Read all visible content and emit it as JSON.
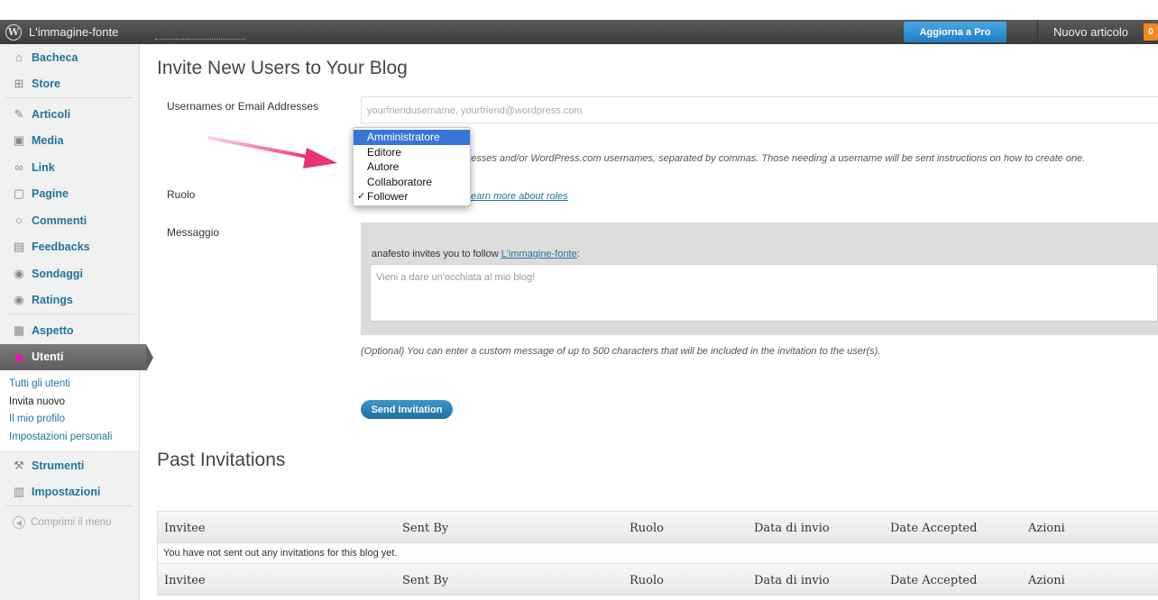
{
  "colors": {
    "adminbar": "#464646",
    "link": "#21759b",
    "upgrade": "#2a8fd3",
    "dropdown_selected": "#3875d7",
    "send_button": "#2b82b5",
    "arrow": "#e8336d"
  },
  "adminbar": {
    "site_name": "L'immagine-fonte",
    "upgrade_label": "Aggiorna a Pro",
    "new_post_label": "Nuovo articolo",
    "notifications_count": "0"
  },
  "sidebar": {
    "items": [
      {
        "label": "Bacheca",
        "icon": "home-icon"
      },
      {
        "label": "Store",
        "icon": "cart-icon"
      },
      {
        "label": "Articoli",
        "icon": "pin-icon"
      },
      {
        "label": "Media",
        "icon": "media-icon"
      },
      {
        "label": "Link",
        "icon": "link-icon"
      },
      {
        "label": "Pagine",
        "icon": "page-icon"
      },
      {
        "label": "Commenti",
        "icon": "comment-icon"
      },
      {
        "label": "Feedbacks",
        "icon": "feedback-icon"
      },
      {
        "label": "Sondaggi",
        "icon": "poll-icon"
      },
      {
        "label": "Ratings",
        "icon": "rating-icon"
      },
      {
        "label": "Aspetto",
        "icon": "appearance-icon"
      },
      {
        "label": "Utenti",
        "icon": "users-icon"
      },
      {
        "label": "Strumenti",
        "icon": "tools-icon"
      },
      {
        "label": "Impostazioni",
        "icon": "settings-icon"
      }
    ],
    "submenu": [
      "Tutti gli utenti",
      "Invita nuovo",
      "Il mio profilo",
      "Impostazioni personali"
    ],
    "collapse_label": "Comprimi il menu"
  },
  "page": {
    "title": "Invite New Users to Your Blog",
    "usernames_label": "Usernames or Email Addresses",
    "usernames_placeholder": "yourfriendusername, yourfriend@wordpress.com",
    "hint": "ldresses and/or WordPress.com usernames, separated by commas. Those needing a username will be sent instructions on how to create one.",
    "role_label": "Ruolo",
    "roles_link": "earn more about roles",
    "message_label": "Messaggio",
    "message_intro": "anafesto invites you to follow ",
    "message_intro_link": "L'immagine-fonte",
    "message_intro_suffix": ":",
    "message_placeholder": "Vieni a dare un'occhiata al mio blog!",
    "optional_note": "(Optional) You can enter a custom message of up to 500 characters that will be included in the invitation to the user(s).",
    "send_label": "Send Invitation",
    "past_title": "Past Invitations"
  },
  "role_dropdown": {
    "options": [
      "Amministratore",
      "Editore",
      "Autore",
      "Collaboratore",
      "Follower"
    ],
    "highlighted": "Amministratore",
    "selected": "Follower"
  },
  "table": {
    "columns": [
      "Invitee",
      "Sent By",
      "Ruolo",
      "Data di invio",
      "Date Accepted",
      "Azioni"
    ],
    "empty_message": "You have not sent out any invitations for this blog yet."
  }
}
